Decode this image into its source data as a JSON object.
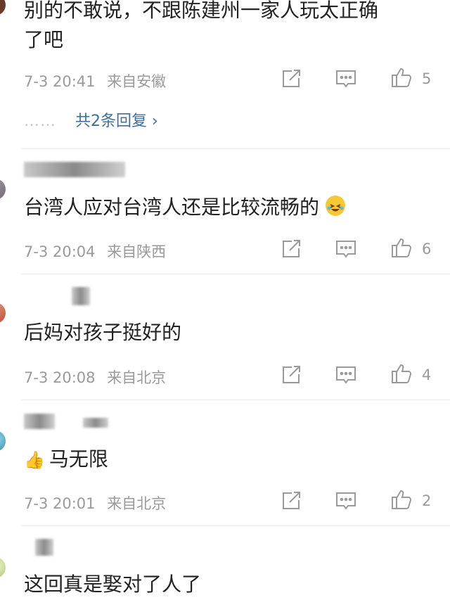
{
  "colors": {
    "text": "#222222",
    "meta": "#9a9a9a",
    "link": "#3d6ea0",
    "divider": "#eaeaea",
    "icon_stroke": "#9a9a9a"
  },
  "comments": [
    {
      "text": "别的不敢说，不跟陈建州一家人玩太正确",
      "text_line2": "了吧",
      "time": "7-3 20:41",
      "source": "来自安徽",
      "likes": "5",
      "replies": {
        "dots": "……",
        "label": "共2条回复 ›"
      }
    },
    {
      "username": "51",
      "text": "台湾人应对台湾人还是比较流畅的",
      "emoji": "laughing-crying-emoji",
      "time": "7-3 20:04",
      "source": "来自陕西",
      "likes": "6"
    },
    {
      "text": "后妈对孩子挺好的",
      "time": "7-3 20:08",
      "source": "来自北京",
      "likes": "4"
    },
    {
      "username": "77",
      "emoji": "thumbs-up-emoji",
      "text": "马无限",
      "time": "7-3 20:01",
      "source": "来自北京",
      "likes": "2"
    },
    {
      "text": "这回真是娶对了人了"
    }
  ]
}
